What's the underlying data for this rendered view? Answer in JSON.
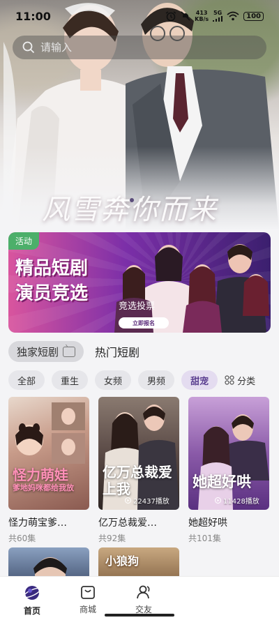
{
  "status_bar": {
    "time": "11:00",
    "net_speed_value": "413",
    "net_speed_unit": "KB/s",
    "network_type": "5G",
    "battery": "100"
  },
  "search": {
    "placeholder": "请输入"
  },
  "hero": {
    "title_overlay": "风雪奔你而来",
    "carousel_dots": 4,
    "carousel_active_index": 2
  },
  "banner": {
    "badge": "活动",
    "title_line1": "精品短剧",
    "title_line2": "演员竞选",
    "subtitle": "竞选投票",
    "cta": "立即报名"
  },
  "section_tabs": {
    "exclusive": "独家短剧",
    "hot": "热门短剧"
  },
  "filters": {
    "chips": [
      "全部",
      "重生",
      "女频",
      "男频",
      "甜宠"
    ],
    "active": "甜宠",
    "category": "分类"
  },
  "dramas": [
    {
      "poster_title": "怪力萌娃",
      "poster_sub": "爹地妈咪都给我放",
      "plays": "",
      "title": "怪力萌宝爹…",
      "episodes": "共60集"
    },
    {
      "poster_title": "亿万总裁爱上我",
      "poster_sub": "",
      "plays": "22437播放",
      "title": "亿万总裁爱…",
      "episodes": "共92集"
    },
    {
      "poster_title": "她超好哄",
      "poster_sub": "",
      "plays": "11428播放",
      "title": "她超好哄",
      "episodes": "共101集"
    }
  ],
  "dramas_row2": [
    {
      "poster_title": ""
    },
    {
      "poster_title": "小狼狗"
    },
    {
      "poster_title": ""
    }
  ],
  "bottom_nav": [
    {
      "label": "首页",
      "icon": "planet-icon",
      "active": true
    },
    {
      "label": "商城",
      "icon": "shopping-bag-icon",
      "active": false
    },
    {
      "label": "交友",
      "icon": "friends-icon",
      "active": false
    }
  ],
  "colors": {
    "accent": "#5b3f90",
    "badge_green": "#4caf6a",
    "chip_active_bg": "#e4dcf0"
  }
}
